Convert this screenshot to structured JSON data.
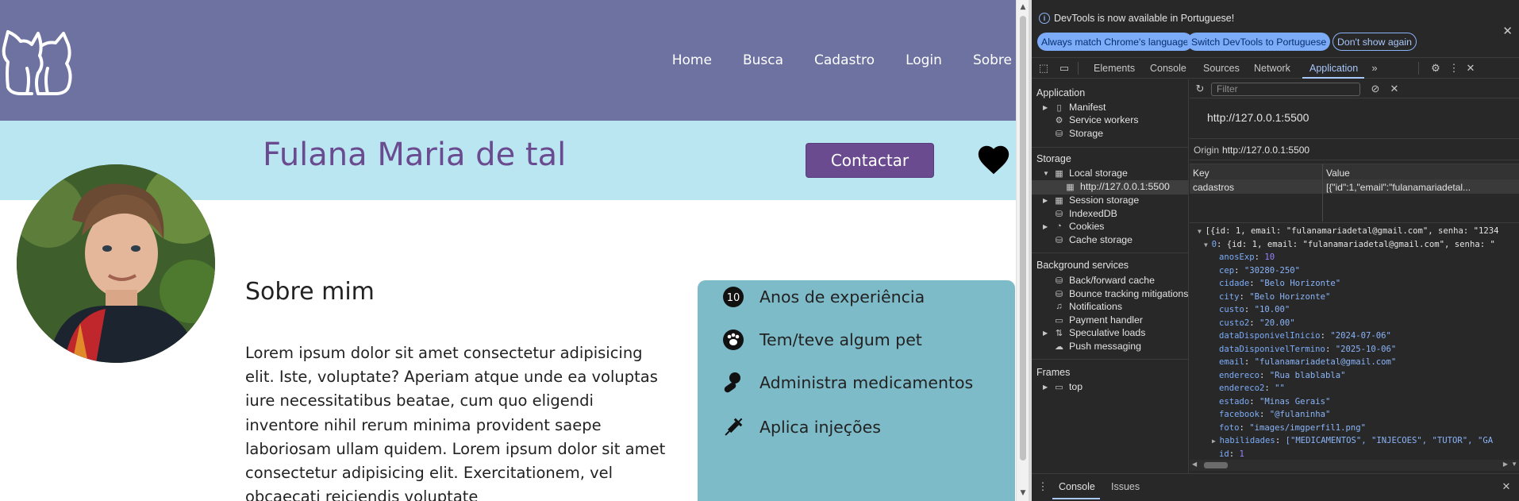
{
  "site": {
    "nav": [
      "Home",
      "Busca",
      "Cadastro",
      "Login",
      "Sobre"
    ],
    "profile_name": "Fulana Maria de tal",
    "contact_label": "Contactar",
    "about_title": "Sobre mim",
    "about_text": "Lorem ipsum dolor sit amet consectetur adipisicing elit. Iste, voluptate? Aperiam atque unde ea voluptas iure necessitatibus beatae, cum quo eligendi inventore nihil rerum minima provident saepe laboriosam ullam quidem. Lorem ipsum dolor sit amet consectetur adipisicing elit. Exercitationem, vel obcaecati reiciendis voluptate",
    "skills": [
      {
        "icon": "number-10-icon",
        "label": "Anos de experiência",
        "badge": "10"
      },
      {
        "icon": "paw-icon",
        "label": "Tem/teve algum pet"
      },
      {
        "icon": "pills-icon",
        "label": "Administra medicamentos"
      },
      {
        "icon": "syringe-icon",
        "label": "Aplica injeções"
      }
    ],
    "colors": {
      "header": "#6d72a0",
      "band": "#bae6f2",
      "accent": "#6b4b90",
      "card": "#7ebbc9"
    }
  },
  "devtools": {
    "info_message": "DevTools is now available in Portuguese!",
    "info_buttons": [
      "Always match Chrome's language",
      "Switch DevTools to Portuguese",
      "Don't show again"
    ],
    "tabs": [
      "Elements",
      "Console",
      "Sources",
      "Network",
      "Application"
    ],
    "active_tab": "Application",
    "sidebar": {
      "application_header": "Application",
      "application_items": [
        "Manifest",
        "Service workers",
        "Storage"
      ],
      "storage_header": "Storage",
      "storage_items": [
        "Local storage",
        "http://127.0.0.1:5500",
        "Session storage",
        "IndexedDB",
        "Cookies",
        "Cache storage"
      ],
      "background_header": "Background services",
      "background_items": [
        "Back/forward cache",
        "Bounce tracking mitigations",
        "Notifications",
        "Payment handler",
        "Speculative loads",
        "Push messaging"
      ],
      "frames_header": "Frames",
      "frames_items": [
        "top"
      ]
    },
    "filter_placeholder": "Filter",
    "origin_url": "http://127.0.0.1:5500",
    "origin_label": "Origin",
    "origin_value": "http://127.0.0.1:5500",
    "table": {
      "headers": [
        "Key",
        "Value"
      ],
      "row_key": "cadastros",
      "row_value": "[{\"id\":1,\"email\":\"fulanamariadetal..."
    },
    "json_lines": [
      {
        "text": "[{id: 1, email: \"fulanamariadetal@gmail.com\", senha: \"1234"
      },
      {
        "text": "0: {id: 1, email: \"fulanamariadetal@gmail.com\", senha: \""
      },
      {
        "key": "anosExp",
        "val": "10",
        "type": "n"
      },
      {
        "key": "cep",
        "val": "\"30280-250\"",
        "type": "s"
      },
      {
        "key": "cidade",
        "val": "\"Belo Horizonte\"",
        "type": "s"
      },
      {
        "key": "city",
        "val": "\"Belo Horizonte\"",
        "type": "s"
      },
      {
        "key": "custo",
        "val": "\"10.00\"",
        "type": "s"
      },
      {
        "key": "custo2",
        "val": "\"20.00\"",
        "type": "s"
      },
      {
        "key": "dataDisponivelInicio",
        "val": "\"2024-07-06\"",
        "type": "s"
      },
      {
        "key": "dataDisponivelTermino",
        "val": "\"2025-10-06\"",
        "type": "s"
      },
      {
        "key": "email",
        "val": "\"fulanamariadetal@gmail.com\"",
        "type": "s"
      },
      {
        "key": "endereco",
        "val": "\"Rua blablabla\"",
        "type": "s"
      },
      {
        "key": "endereco2",
        "val": "\"\"",
        "type": "s"
      },
      {
        "key": "estado",
        "val": "\"Minas Gerais\"",
        "type": "s"
      },
      {
        "key": "facebook",
        "val": "\"@fulaninha\"",
        "type": "s"
      },
      {
        "key": "foto",
        "val": "\"images/imgperfil1.png\"",
        "type": "s"
      },
      {
        "key": "habilidades",
        "val": "[\"MEDICAMENTOS\", \"INJECOES\", \"TUTOR\", \"GA",
        "type": "s"
      },
      {
        "key": "id",
        "val": "1",
        "type": "n"
      }
    ],
    "drawer_tabs": [
      "Console",
      "Issues"
    ]
  }
}
